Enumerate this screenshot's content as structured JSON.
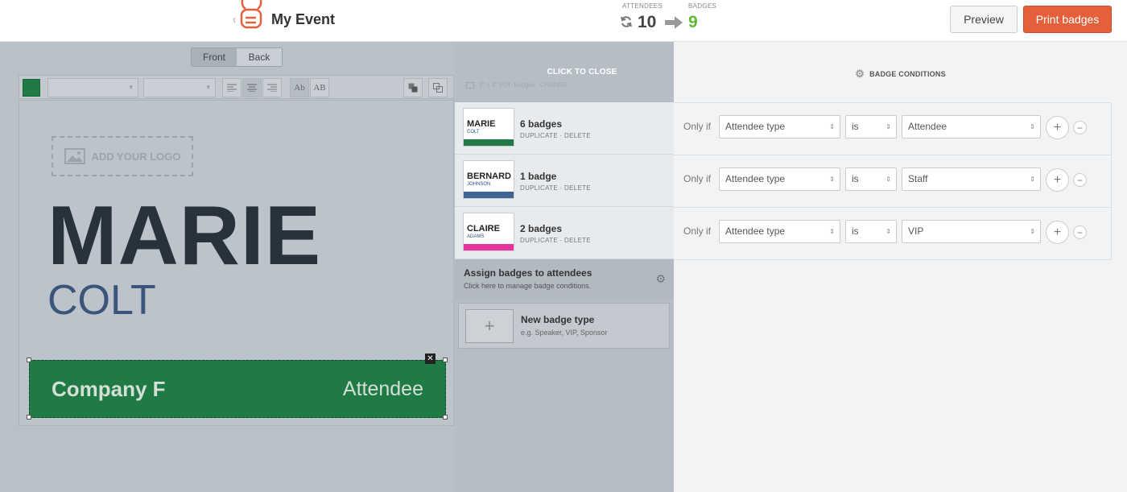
{
  "header": {
    "event_name": "My Event",
    "attendees_label": "ATTENDEES",
    "attendees_count": "10",
    "badges_label": "BADGES",
    "badges_count": "9",
    "preview_label": "Preview",
    "print_label": "Print badges"
  },
  "colors": {
    "accent": "#e5603a",
    "badge_count": "#5fb830",
    "strip_green": "#1f7a45",
    "strip_blue": "#3d6494",
    "strip_pink": "#e6359a"
  },
  "editor": {
    "front_label": "Front",
    "back_label": "Back",
    "logo_placeholder": "ADD YOUR LOGO",
    "first_name": "MARIE",
    "last_name": "COLT",
    "company": "Company F",
    "attendee_type": "Attendee",
    "style_btn_1": "Ab",
    "style_btn_2": "AB"
  },
  "middle": {
    "click_to_close": "CLICK TO CLOSE",
    "pdf_size": "2\" x 4\" PDF badges",
    "change_label": "CHANGE",
    "badge_types": [
      {
        "first": "MARIE",
        "last": "COLT",
        "title": "6 badges",
        "actions": "DUPLICATE · DELETE",
        "strip_color": "#1f7a45"
      },
      {
        "first": "BERNARD",
        "last": "JOHNSON",
        "title": "1 badge",
        "actions": "DUPLICATE · DELETE",
        "strip_color": "#3d6494"
      },
      {
        "first": "CLAIRE",
        "last": "ADAMS",
        "title": "2 badges",
        "actions": "DUPLICATE · DELETE",
        "strip_color": "#e6359a"
      }
    ],
    "assign_title": "Assign badges to attendees",
    "assign_sub": "Click here to manage badge conditions.",
    "new_badge_title": "New badge type",
    "new_badge_sub": "e.g. Speaker, VIP, Sponsor"
  },
  "conditions": {
    "header": "BADGE CONDITIONS",
    "rows": [
      {
        "prefix": "Only if",
        "field": "Attendee type",
        "op": "is",
        "value": "Attendee"
      },
      {
        "prefix": "Only if",
        "field": "Attendee type",
        "op": "is",
        "value": "Staff"
      },
      {
        "prefix": "Only if",
        "field": "Attendee type",
        "op": "is",
        "value": "VIP"
      }
    ]
  }
}
